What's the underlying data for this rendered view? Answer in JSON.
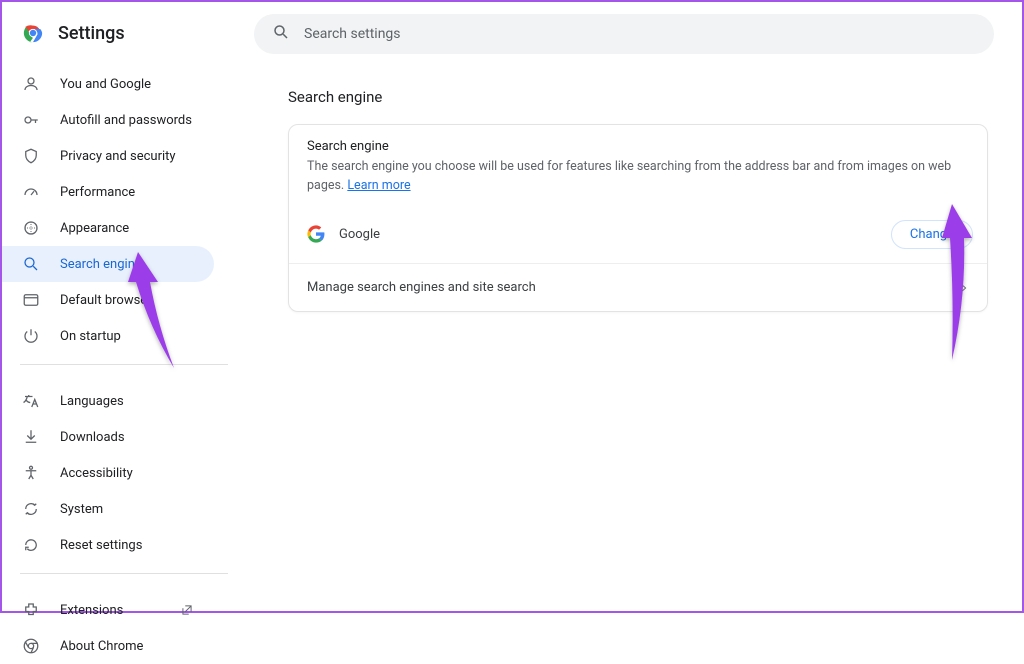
{
  "header": {
    "title": "Settings"
  },
  "search": {
    "placeholder": "Search settings"
  },
  "sidebar": {
    "items": [
      {
        "label": "You and Google"
      },
      {
        "label": "Autofill and passwords"
      },
      {
        "label": "Privacy and security"
      },
      {
        "label": "Performance"
      },
      {
        "label": "Appearance"
      },
      {
        "label": "Search engine"
      },
      {
        "label": "Default browser"
      },
      {
        "label": "On startup"
      }
    ],
    "items2": [
      {
        "label": "Languages"
      },
      {
        "label": "Downloads"
      },
      {
        "label": "Accessibility"
      },
      {
        "label": "System"
      },
      {
        "label": "Reset settings"
      }
    ],
    "items3": [
      {
        "label": "Extensions"
      },
      {
        "label": "About Chrome"
      }
    ]
  },
  "main": {
    "section_title": "Search engine",
    "card": {
      "title": "Search engine",
      "description": "The search engine you choose will be used for features like searching from the address bar and from images on web pages. ",
      "learn_more": "Learn more",
      "current_engine": "Google",
      "change_button": "Change",
      "manage_label": "Manage search engines and site search"
    }
  }
}
